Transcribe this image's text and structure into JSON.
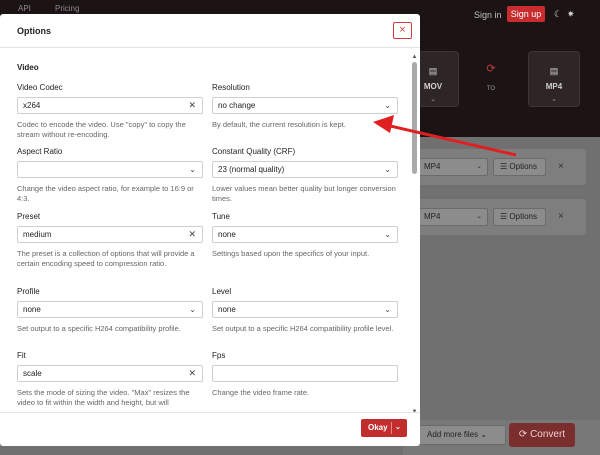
{
  "background": {
    "nav_links": [
      "API",
      "Pricing"
    ],
    "sign_in": "Sign in",
    "sign_up": "Sign up",
    "mode_icons": [
      "moon-icon",
      "sun-icon"
    ],
    "from_format": "MOV",
    "to_label": "TO",
    "to_format": "MP4",
    "rows": [
      {
        "format": "MP4",
        "options_label": "Options"
      },
      {
        "format": "MP4",
        "options_label": "Options"
      }
    ],
    "add_more_label": "Add more files",
    "convert_label": "Convert"
  },
  "modal": {
    "title": "Options",
    "close_icon": "close-icon",
    "section": "Video",
    "fields": {
      "video_codec": {
        "label": "Video Codec",
        "value": "x264",
        "help": "Codec to encode the video. Use \"copy\" to copy the stream without re-encoding."
      },
      "resolution": {
        "label": "Resolution",
        "value": "no change",
        "help": "By default, the current resolution is kept."
      },
      "aspect_ratio": {
        "label": "Aspect Ratio",
        "value": "",
        "help": "Change the video aspect ratio, for example to 16:9 or 4:3."
      },
      "crf": {
        "label": "Constant Quality (CRF)",
        "value": "23 (normal quality)",
        "help": "Lower values mean better quality but longer conversion times."
      },
      "preset": {
        "label": "Preset",
        "value": "medium",
        "help": "The preset is a collection of options that will provide a certain encoding speed to compression ratio."
      },
      "tune": {
        "label": "Tune",
        "value": "none",
        "help": "Settings based upon the specifics of your input."
      },
      "profile": {
        "label": "Profile",
        "value": "none",
        "help": "Set output to a specific H264 compatibility profile."
      },
      "level": {
        "label": "Level",
        "value": "none",
        "help": "Set output to a specific H264 compatibility profile level."
      },
      "fit": {
        "label": "Fit",
        "value": "scale",
        "help": "Sets the mode of sizing the video. \"Max\" resizes the video to fit within the width and height, but will"
      },
      "fps": {
        "label": "Fps",
        "value": "",
        "help": "Change the video frame rate."
      }
    },
    "okay_label": "Okay"
  },
  "colors": {
    "accent": "#c22e2e",
    "annotation_arrow": "#e02020"
  }
}
